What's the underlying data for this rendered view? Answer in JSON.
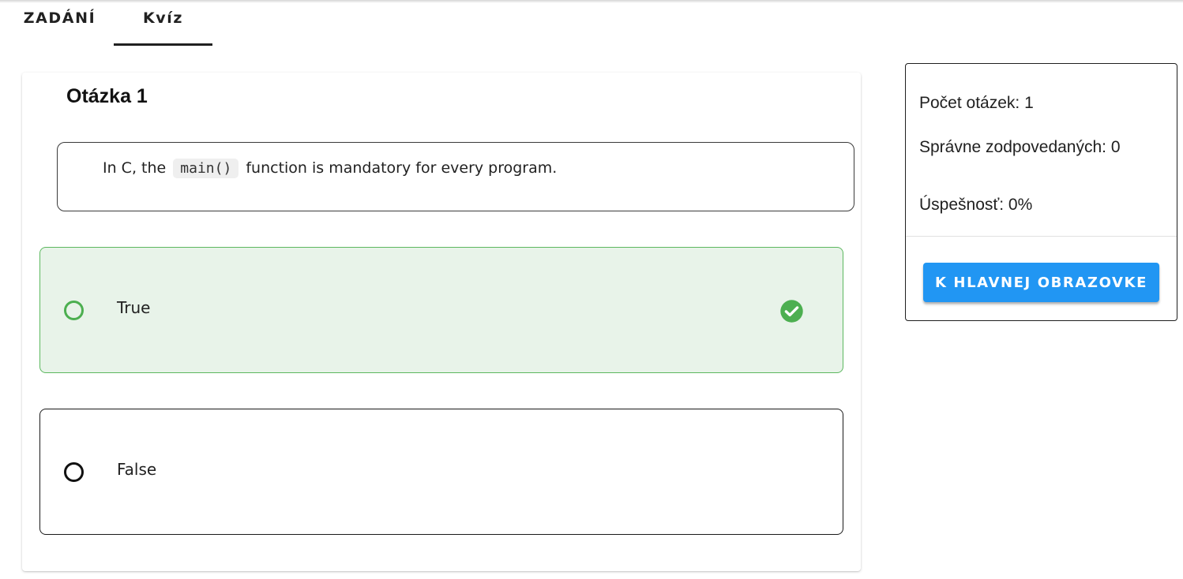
{
  "tabs": [
    {
      "label": "ZADÁNÍ",
      "active": false
    },
    {
      "label": "Kvíz",
      "active": true
    }
  ],
  "question": {
    "title": "Otázka 1",
    "text_before": "In C, the",
    "code": "main()",
    "text_after": "function is mandatory for every program."
  },
  "options": [
    {
      "label": "True",
      "state": "correct",
      "icon": "check-circle-icon"
    },
    {
      "label": "False",
      "state": "default"
    }
  ],
  "stats": {
    "count": "Počet otázek: 1",
    "correct": "Správne zodpovedaných: 0",
    "success": "Úspešnosť: 0%"
  },
  "home_button": "K HLAVNEJ OBRAZOVKE",
  "colors": {
    "primary": "#2196f3",
    "correct_border": "#5cb85f",
    "correct_bg": "#e8f3e9",
    "check": "#4caf50"
  }
}
